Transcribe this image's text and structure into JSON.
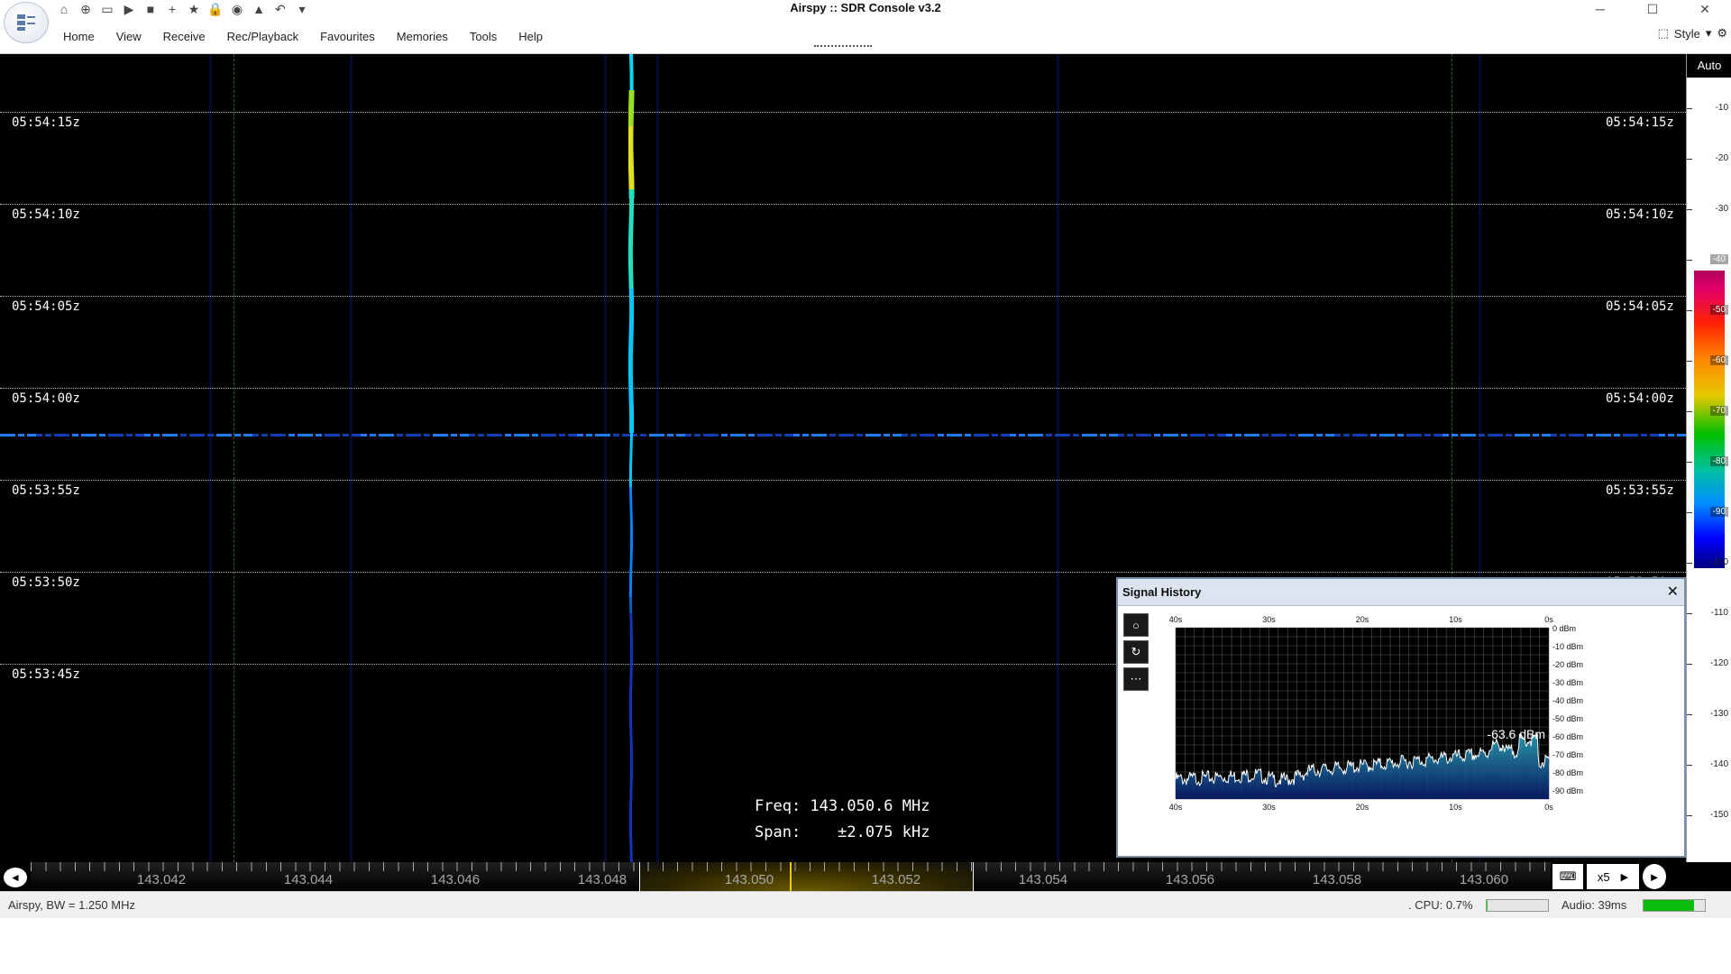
{
  "window": {
    "title": "Airspy :: SDR Console v3.2",
    "minimize_glyph": "─",
    "maximize_glyph": "☐",
    "close_glyph": "✕"
  },
  "quick_access": [
    {
      "icon": "home-icon",
      "glyph": "⌂"
    },
    {
      "icon": "lifebuoy-icon",
      "glyph": "⊕"
    },
    {
      "icon": "folder-icon",
      "glyph": "▭"
    },
    {
      "icon": "play-icon",
      "glyph": "▶"
    },
    {
      "icon": "stop-icon",
      "glyph": "■"
    },
    {
      "icon": "add-icon",
      "glyph": "+"
    },
    {
      "icon": "star-icon",
      "glyph": "★"
    },
    {
      "icon": "lock-icon",
      "glyph": "🔒"
    },
    {
      "icon": "camera-icon",
      "glyph": "◉"
    },
    {
      "icon": "flask-icon",
      "glyph": "▲"
    },
    {
      "icon": "undo-icon",
      "glyph": "↶"
    },
    {
      "icon": "dropdown-icon",
      "glyph": "▾"
    }
  ],
  "menu": [
    "Home",
    "View",
    "Receive",
    "Rec/Playback",
    "Favourites",
    "Memories",
    "Tools",
    "Help"
  ],
  "style_label": "Style",
  "waterfall": {
    "time_labels": [
      "05:54:15z",
      "05:54:10z",
      "05:54:05z",
      "05:54:00z",
      "05:53:55z",
      "05:53:50z",
      "05:53:45z"
    ],
    "freq_readout": "Freq: 143.050.6 MHz",
    "span_readout": "Span:    ±2.075 kHz"
  },
  "scale": {
    "auto_label": "Auto",
    "ticks": [
      "-10",
      "-20",
      "-30",
      "-40",
      "-50",
      "-60",
      "-70",
      "-80",
      "-90",
      "-100",
      "-110",
      "-120",
      "-130",
      "-140",
      "-150"
    ]
  },
  "freq_axis": {
    "labels": [
      "143.042",
      "143.044",
      "143.046",
      "143.048",
      "143.050",
      "143.052",
      "143.054",
      "143.056",
      "143.058",
      "143.060"
    ],
    "zoom_label": "x5",
    "keyboard_icon": "keyboard-icon"
  },
  "status": {
    "left": "Airspy, BW = 1.250 MHz",
    "cpu": ". CPU: 0.7%",
    "cpu_percent": 0.7,
    "audio": "Audio: 39ms",
    "audio_level": 0.82
  },
  "signal_history": {
    "title": "Signal History",
    "time_labels": [
      "40s",
      "30s",
      "20s",
      "10s",
      "0s"
    ],
    "dbm_labels": [
      "0 dBm",
      "-10 dBm",
      "-20 dBm",
      "-30 dBm",
      "-40 dBm",
      "-50 dBm",
      "-60 dBm",
      "-70 dBm",
      "-80 dBm",
      "-90 dBm"
    ],
    "current_value": "-63.6 dBm",
    "ylim": [
      -95,
      0
    ]
  },
  "colors": {
    "accent": "#0078d7",
    "waterfall_bg": "#000000",
    "trace": "#00d8ff",
    "passband": "#6a5a00",
    "tuning_marker": "#e6d000"
  }
}
